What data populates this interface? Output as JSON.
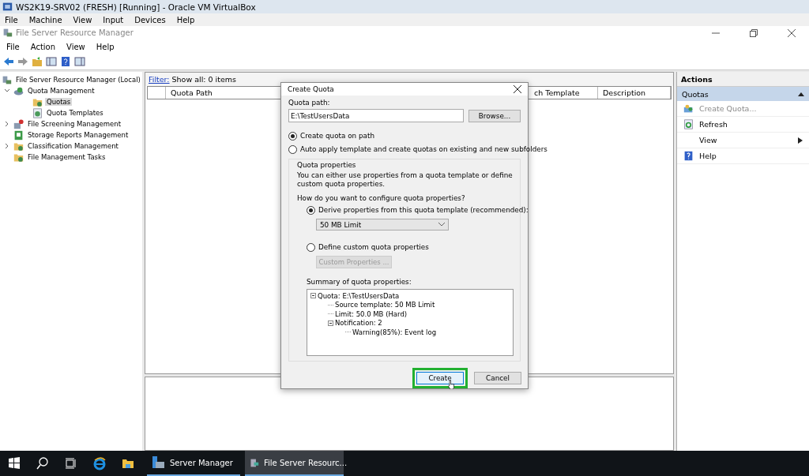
{
  "host_window": {
    "title": "WS2K19-SRV02 (FRESH) [Running] - Oracle VM VirtualBox",
    "menu": [
      "File",
      "Machine",
      "View",
      "Input",
      "Devices",
      "Help"
    ]
  },
  "app_window": {
    "title": "File Server Resource Manager",
    "menu": [
      "File",
      "Action",
      "View",
      "Help"
    ]
  },
  "tree": [
    {
      "label": "File Server Resource Manager (Local)",
      "selected": false,
      "children": [
        {
          "label": "Quota Management",
          "expanded": true,
          "selected": false,
          "children": [
            {
              "label": "Quotas",
              "selected": true
            },
            {
              "label": "Quota Templates",
              "selected": false
            }
          ]
        },
        {
          "label": "File Screening Management",
          "expanded": false,
          "selected": false
        },
        {
          "label": "Storage Reports Management",
          "selected": false
        },
        {
          "label": "Classification Management",
          "expanded": false,
          "selected": false
        },
        {
          "label": "File Management Tasks",
          "selected": false
        }
      ]
    }
  ],
  "center": {
    "filter_link": "Filter:",
    "filter_text": "Show all: 0 items",
    "columns": [
      "Quota Path",
      "ch Template",
      "Description"
    ]
  },
  "actions": {
    "title": "Actions",
    "section": "Quotas",
    "items": [
      {
        "label": "Create Quota...",
        "disabled": true,
        "kind": "plain"
      },
      {
        "label": "Refresh",
        "disabled": false,
        "kind": "plain"
      },
      {
        "label": "View",
        "disabled": false,
        "kind": "submenu"
      },
      {
        "label": "Help",
        "disabled": false,
        "kind": "plain"
      }
    ]
  },
  "dialog": {
    "title": "Create Quota",
    "path_label": "Quota path:",
    "path_value": "E:\\TestUsersData",
    "browse": "Browse...",
    "modes": [
      {
        "label": "Create quota on path",
        "selected": true
      },
      {
        "label": "Auto apply template and create quotas on existing and new subfolders",
        "selected": false
      }
    ],
    "group_title": "Quota properties",
    "description": "You can either use properties from a quota template or define custom quota properties.",
    "question": "How do you want to configure quota properties?",
    "sources": [
      {
        "label": "Derive properties from this quota template (recommended):",
        "selected": true
      },
      {
        "label": "Define custom quota properties",
        "selected": false
      }
    ],
    "template": "50 MB Limit",
    "custom_button": {
      "label": "Custom Properties ...",
      "disabled": true
    },
    "summary_label": "Summary of quota properties:",
    "summary": [
      {
        "label": "Quota: E:\\TestUsersData",
        "children": [
          {
            "label": "Source template: 50 MB Limit"
          },
          {
            "label": "Limit: 50.0 MB (Hard)"
          },
          {
            "label": "Notification: 2",
            "children": [
              {
                "label": "Warning(85%): Event log"
              }
            ]
          }
        ]
      }
    ],
    "buttons": [
      {
        "label": "Create",
        "highlighted": true
      },
      {
        "label": "Cancel",
        "highlighted": false
      }
    ]
  },
  "taskbar": {
    "apps": [
      {
        "label": "Server Manager",
        "active": false
      },
      {
        "label": "File Server Resourc...",
        "active": true
      }
    ]
  }
}
